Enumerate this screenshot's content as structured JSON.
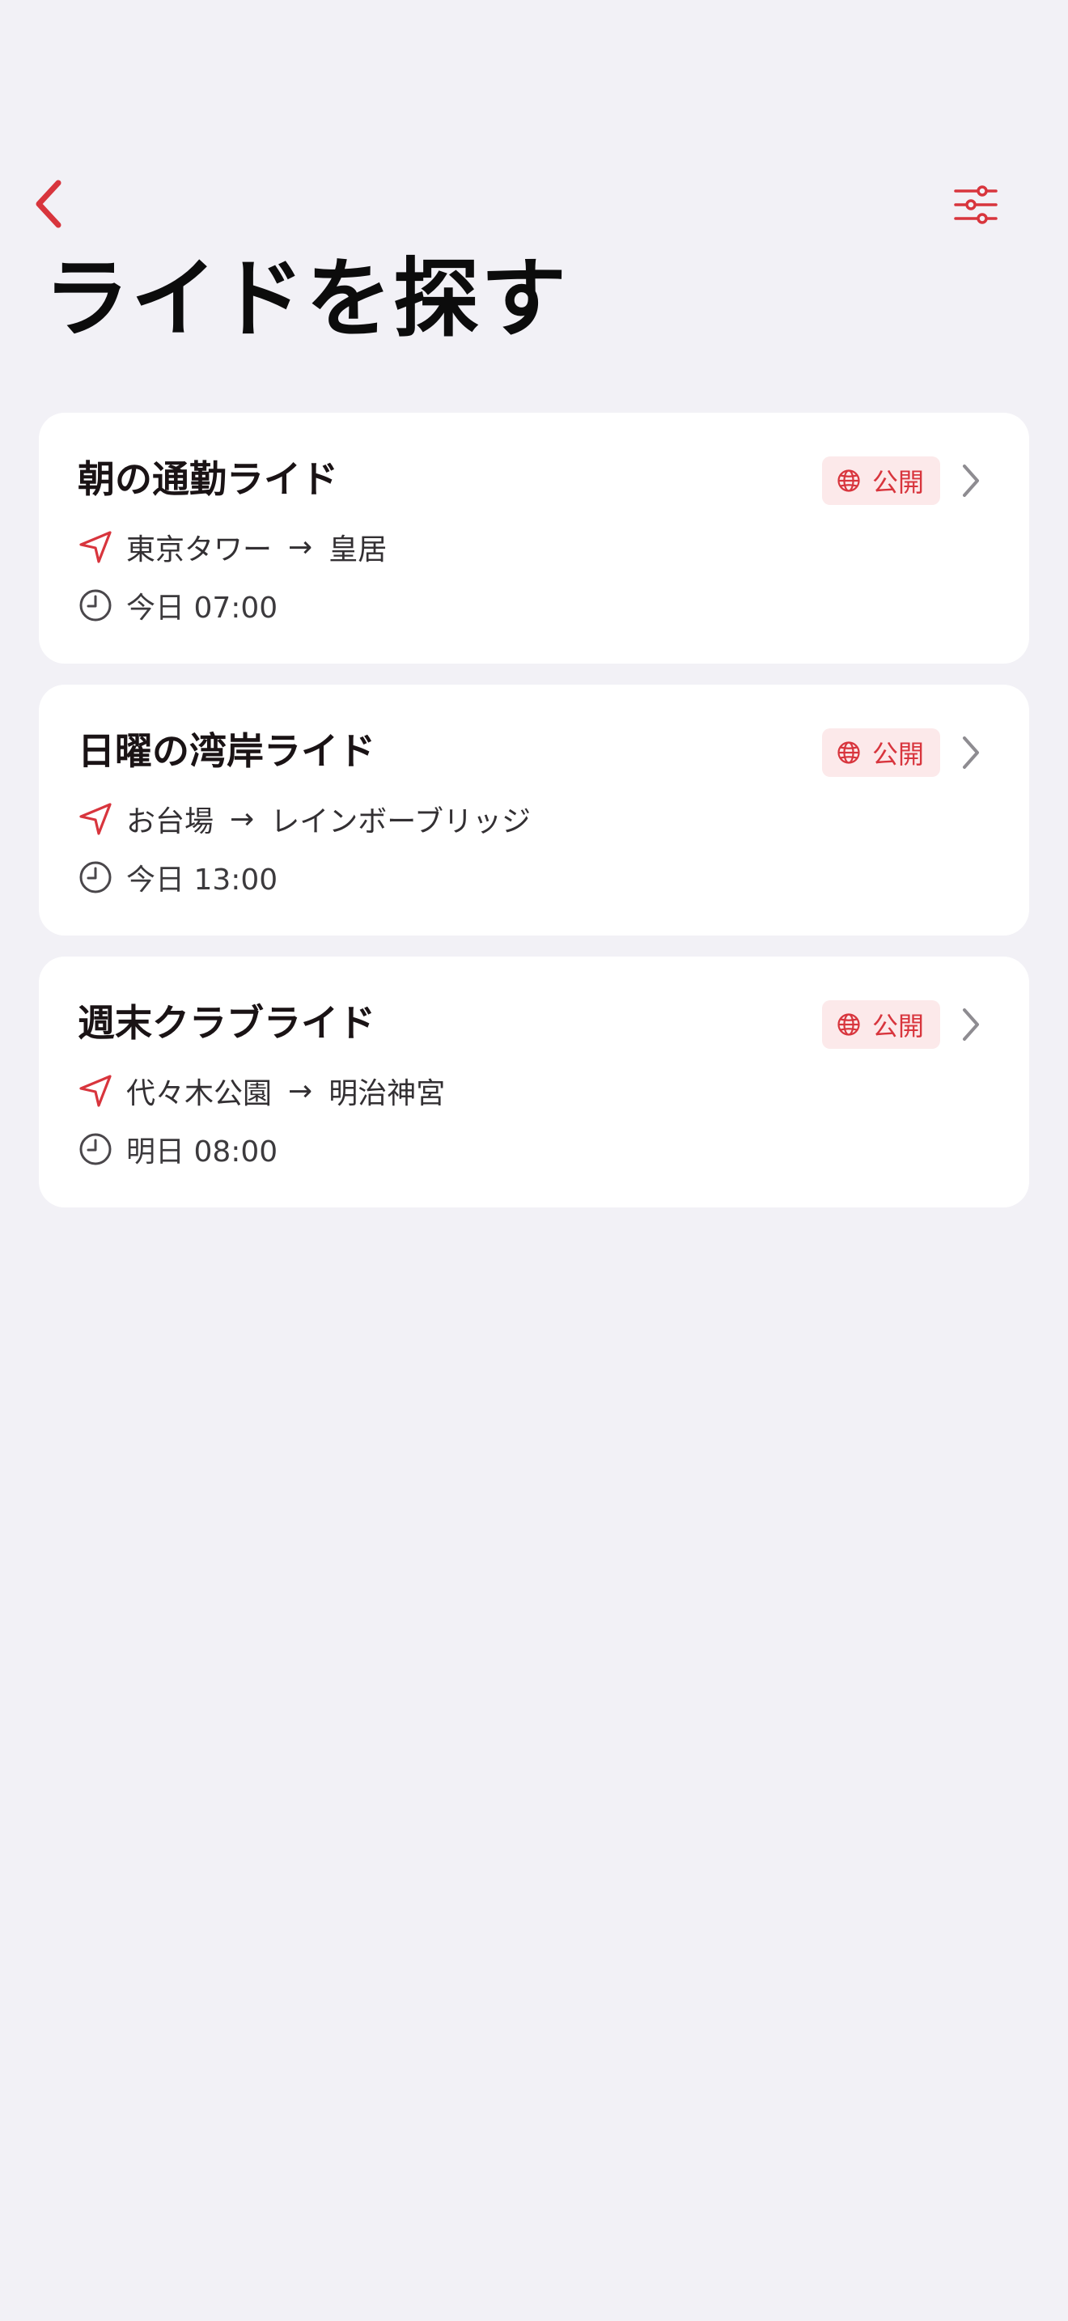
{
  "header": {
    "title": "ライドを探す",
    "back_icon": "chevron-left-icon",
    "filter_icon": "sliders-icon"
  },
  "colors": {
    "accent": "#d8353d",
    "background": "#f2f1f6",
    "card": "#ffffff",
    "badge_bg": "#fce9ea"
  },
  "rides": [
    {
      "title": "朝の通勤ライド",
      "badge": "公開",
      "from": "東京タワー",
      "arrow": "→",
      "to": "皇居",
      "time": "今日 07:00"
    },
    {
      "title": "日曜の湾岸ライド",
      "badge": "公開",
      "from": "お台場",
      "arrow": "→",
      "to": "レインボーブリッジ",
      "time": "今日 13:00"
    },
    {
      "title": "週末クラブライド",
      "badge": "公開",
      "from": "代々木公園",
      "arrow": "→",
      "to": "明治神宮",
      "time": "明日 08:00"
    }
  ]
}
